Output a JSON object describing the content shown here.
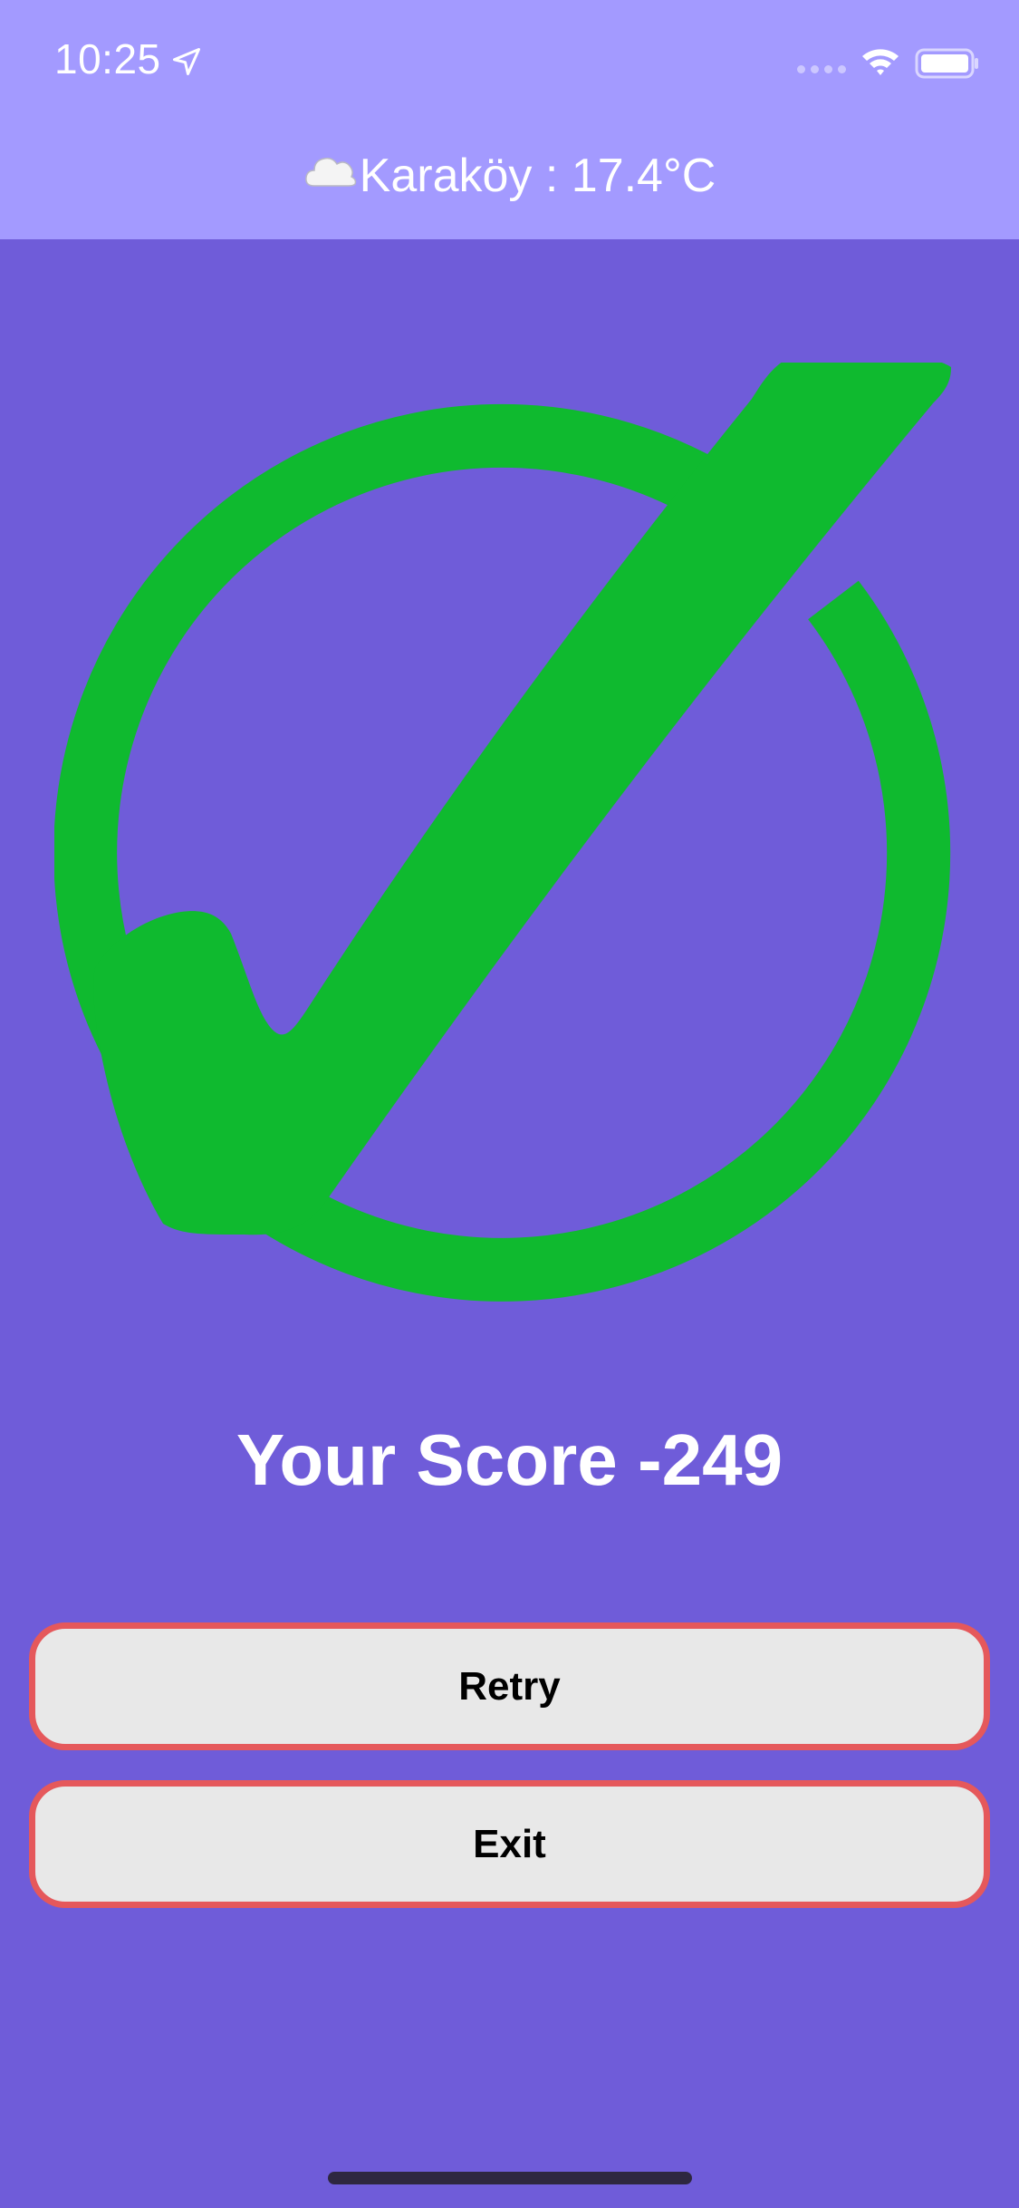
{
  "status_bar": {
    "time": "10:25",
    "icons": [
      "location-arrow-icon",
      "cellular-signal-icon",
      "wifi-icon",
      "battery-icon"
    ]
  },
  "header": {
    "weather_icon": "cloud-icon",
    "weather_text": "Karaköy : 17.4°C"
  },
  "result": {
    "icon": "check-circle-icon",
    "score_text": "Your Score -249"
  },
  "buttons": {
    "retry_label": "Retry",
    "exit_label": "Exit"
  },
  "colors": {
    "background": "#6f5cd9",
    "header_background": "#a39aff",
    "check_green": "#0fba2f",
    "button_border": "#e5585b",
    "button_fill": "#e8e8e8"
  }
}
